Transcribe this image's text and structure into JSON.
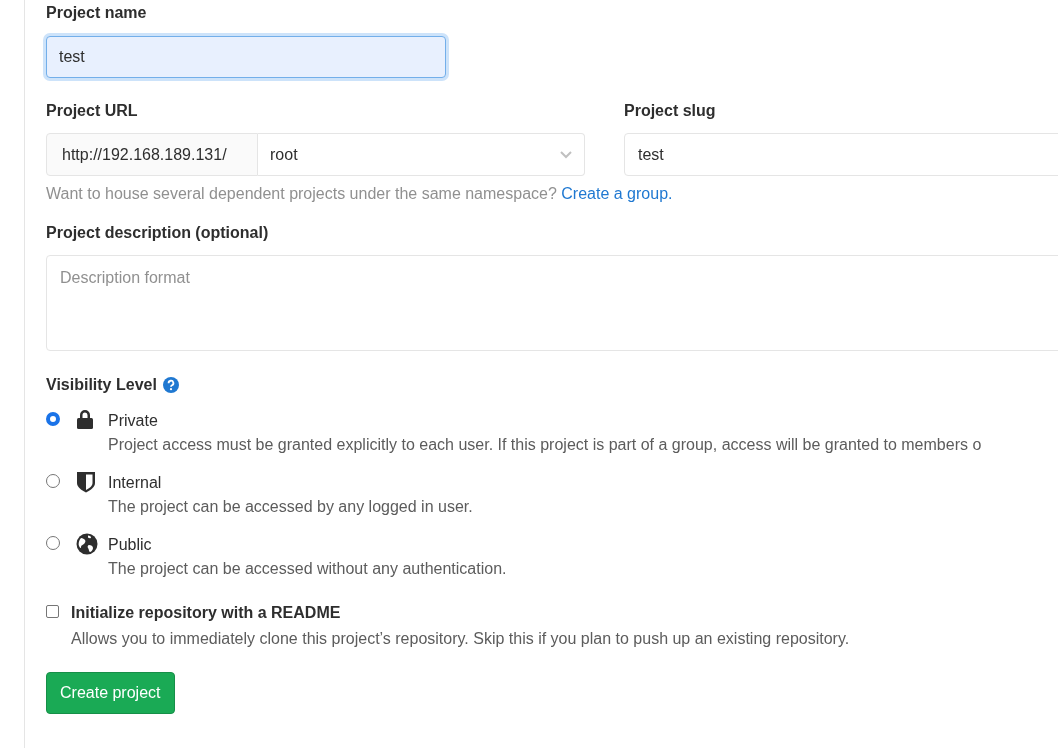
{
  "project_name": {
    "label": "Project name",
    "value": "test",
    "focused": true
  },
  "project_url": {
    "label": "Project URL",
    "prefix": "http://192.168.189.131/",
    "namespace": "root"
  },
  "project_slug": {
    "label": "Project slug",
    "value": "test"
  },
  "namespace_hint": {
    "text": "Want to house several dependent projects under the same namespace?",
    "link": "Create a group."
  },
  "description": {
    "label": "Project description (optional)",
    "placeholder": "Description format"
  },
  "visibility": {
    "label": "Visibility Level",
    "options": [
      {
        "kind": "lock",
        "label": "Private",
        "description": "Project access must be granted explicitly to each user. If this project is part of a group, access will be granted to members o",
        "selected": true
      },
      {
        "kind": "shield",
        "label": "Internal",
        "description": "The project can be accessed by any logged in user.",
        "selected": false
      },
      {
        "kind": "globe",
        "label": "Public",
        "description": "The project can be accessed without any authentication.",
        "selected": false
      }
    ]
  },
  "readme": {
    "label": "Initialize repository with a README",
    "description": "Allows you to immediately clone this project’s repository. Skip this if you plan to push up an existing repository.",
    "checked": false
  },
  "submit": {
    "label": "Create project"
  }
}
